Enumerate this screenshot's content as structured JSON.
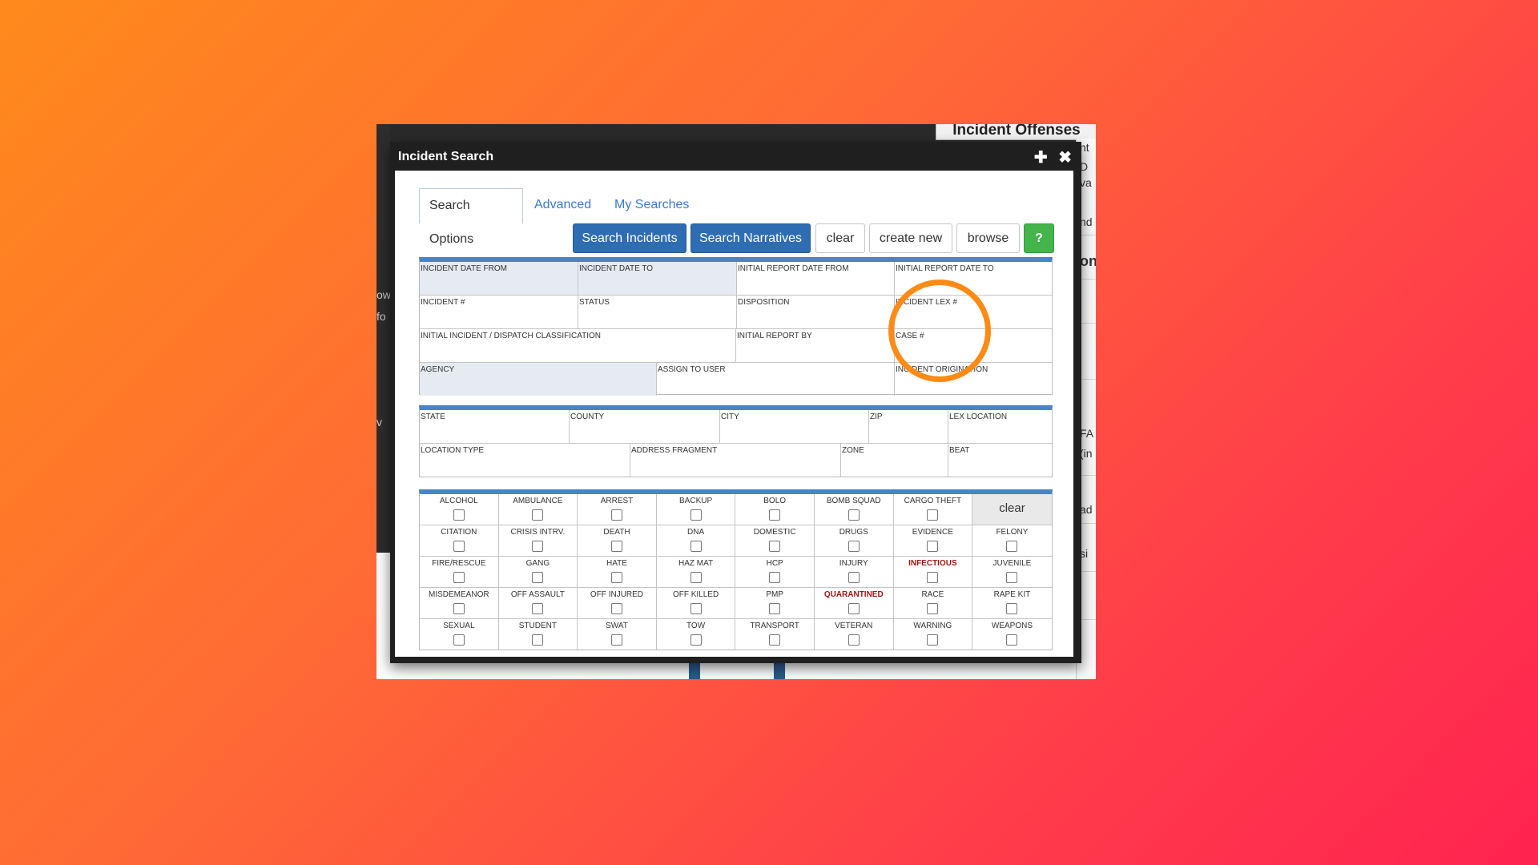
{
  "background_app": {
    "left_texts": [
      "ow",
      "fo",
      "v"
    ],
    "right_texts": [
      "nt",
      "D",
      "va",
      "nd",
      "on",
      "FA",
      "(in",
      "ad",
      "si"
    ],
    "offenses_tab": "Incident Offenses"
  },
  "dialog": {
    "title": "Incident Search",
    "plus_icon": "✚",
    "close_icon": "✖"
  },
  "tabs": {
    "search_options": "Search Options",
    "advanced": "Advanced",
    "my_searches": "My Searches"
  },
  "toolbar": {
    "search_incidents": "Search Incidents",
    "search_narratives": "Search Narratives",
    "clear": "clear",
    "create_new": "create new",
    "browse": "browse",
    "help": "?"
  },
  "incident_fields": {
    "date_from": "INCIDENT DATE FROM",
    "date_to": "INCIDENT DATE TO",
    "report_date_from": "INITIAL REPORT DATE FROM",
    "report_date_to": "INITIAL REPORT DATE TO",
    "incident_num": "INCIDENT #",
    "status": "STATUS",
    "disposition": "DISPOSITION",
    "incident_lex": "INCIDENT LEX #",
    "classification": "INITIAL INCIDENT / DISPATCH CLASSIFICATION",
    "report_by": "INITIAL REPORT BY",
    "case_num": "CASE #",
    "agency": "AGENCY",
    "assign_to_user": "ASSIGN TO USER",
    "origination": "INCIDENT ORIGINATION"
  },
  "location_fields": {
    "state": "STATE",
    "county": "COUNTY",
    "city": "CITY",
    "zip": "ZIP",
    "lex_location": "LEX LOCATION",
    "location_type": "LOCATION TYPE",
    "address_fragment": "ADDRESS FRAGMENT",
    "zone": "ZONE",
    "beat": "BEAT"
  },
  "flags": {
    "clear_label": "clear",
    "rows": [
      [
        "ALCOHOL",
        "AMBULANCE",
        "ARREST",
        "BACKUP",
        "BOLO",
        "BOMB SQUAD",
        "CARGO THEFT"
      ],
      [
        "CITATION",
        "CRISIS INTRV.",
        "DEATH",
        "DNA",
        "DOMESTIC",
        "DRUGS",
        "EVIDENCE",
        "FELONY"
      ],
      [
        "FIRE/RESCUE",
        "GANG",
        "HATE",
        "HAZ MAT",
        "HCP",
        "INJURY",
        "INFECTIOUS",
        "JUVENILE"
      ],
      [
        "MISDEMEANOR",
        "OFF ASSAULT",
        "OFF INJURED",
        "OFF KILLED",
        "PMP",
        "QUARANTINED",
        "RACE",
        "RAPE KIT"
      ],
      [
        "SEXUAL",
        "STUDENT",
        "SWAT",
        "TOW",
        "TRANSPORT",
        "VETERAN",
        "WARNING",
        "WEAPONS"
      ]
    ],
    "alert_labels": [
      "INFECTIOUS",
      "QUARANTINED"
    ],
    "alert_color": "#a31515"
  },
  "colors": {
    "accent_blue": "#2f6db3",
    "help_green": "#43b54a",
    "highlight_ring": "#ff8a14"
  }
}
